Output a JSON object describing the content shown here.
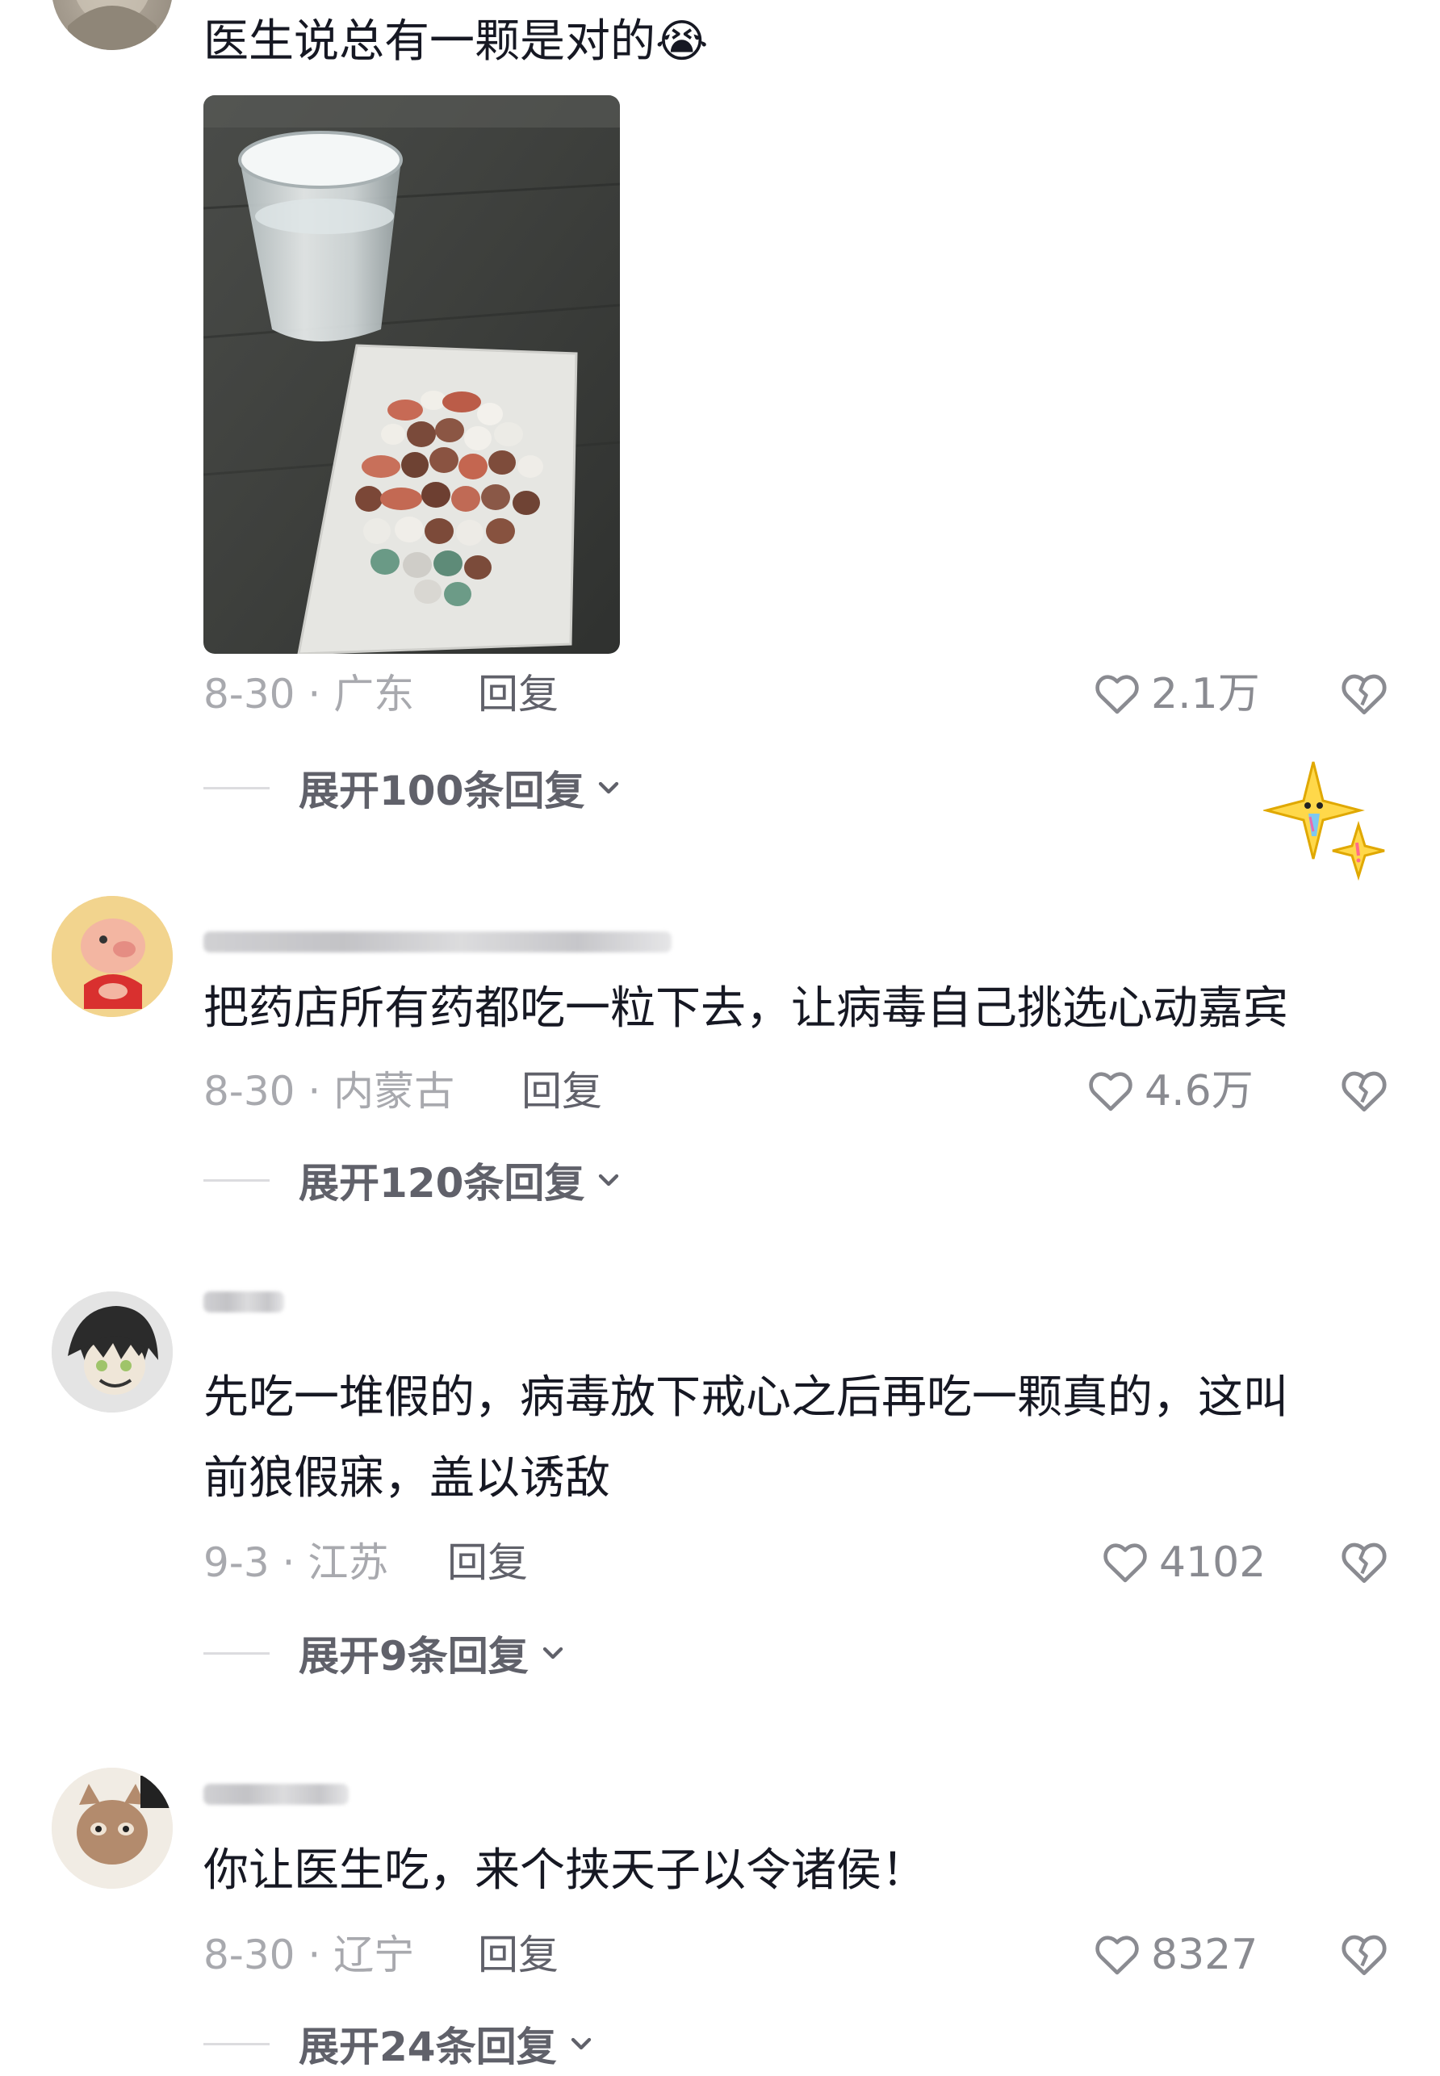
{
  "comments": [
    {
      "text_lines": [
        "医生说总有一颗是对的😭"
      ],
      "date_location": "8-30 · 广东",
      "reply_label": "回复",
      "likes": "2.1万",
      "expand_label": "展开100条回复"
    },
    {
      "text_lines": [
        "把药店所有药都吃一粒下去，让病毒自己挑选心动嘉宾"
      ],
      "date_location": "8-30 · 内蒙古",
      "reply_label": "回复",
      "likes": "4.6万",
      "expand_label": "展开120条回复"
    },
    {
      "text_lines": [
        "先吃一堆假的，病毒放下戒心之后再吃一颗真的，这叫",
        "前狼假寐，盖以诱敌"
      ],
      "date_location": "9-3 · 江苏",
      "reply_label": "回复",
      "likes": "4102",
      "expand_label": "展开9条回复"
    },
    {
      "text_lines": [
        "你让医生吃，来个挟天子以令诸侯！"
      ],
      "date_location": "8-30 · 辽宁",
      "reply_label": "回复",
      "likes": "8327",
      "expand_label": "展开24条回复"
    }
  ],
  "colors": {
    "text": "#161823",
    "meta": "#a8a9ae",
    "action": "#60616a",
    "divider": "#dcdcdf"
  },
  "icons": {
    "like": "heart-outline-icon",
    "dislike": "broken-heart-icon",
    "expand": "chevron-down-icon",
    "sticker": "sparkle-star-sticker-icon"
  }
}
